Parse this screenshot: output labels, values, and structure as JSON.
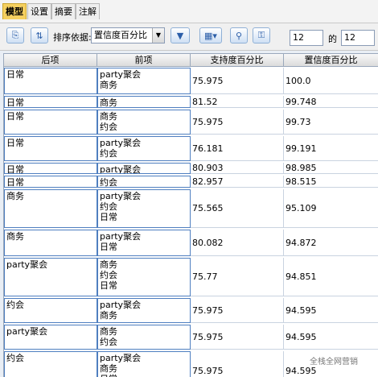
{
  "tabs": [
    "模型",
    "设置",
    "摘要",
    "注解"
  ],
  "toolbar": {
    "sort_label": "排序依据:",
    "sort_value": "置信度百分比",
    "page_current": "12",
    "of_label": "的",
    "page_total": "12"
  },
  "table": {
    "headers": [
      "后项",
      "前项",
      "支持度百分比",
      "置信度百分比"
    ],
    "rows": [
      {
        "consequent": "日常",
        "antecedents": [
          "party聚会",
          "商务"
        ],
        "support": "75.975",
        "confidence": "100.0"
      },
      {
        "consequent": "日常",
        "antecedents": [
          "商务"
        ],
        "support": "81.52",
        "confidence": "99.748"
      },
      {
        "consequent": "日常",
        "antecedents": [
          "商务",
          "约会"
        ],
        "support": "75.975",
        "confidence": "99.73"
      },
      {
        "consequent": "日常",
        "antecedents": [
          "party聚会",
          "约会"
        ],
        "support": "76.181",
        "confidence": "99.191"
      },
      {
        "consequent": "日常",
        "antecedents": [
          "party聚会"
        ],
        "support": "80.903",
        "confidence": "98.985"
      },
      {
        "consequent": "日常",
        "antecedents": [
          "约会"
        ],
        "support": "82.957",
        "confidence": "98.515"
      },
      {
        "consequent": "商务",
        "antecedents": [
          "party聚会",
          "约会",
          "日常"
        ],
        "support": "75.565",
        "confidence": "95.109"
      },
      {
        "consequent": "商务",
        "antecedents": [
          "party聚会",
          "日常"
        ],
        "support": "80.082",
        "confidence": "94.872"
      },
      {
        "consequent": "party聚会",
        "antecedents": [
          "商务",
          "约会",
          "日常"
        ],
        "support": "75.77",
        "confidence": "94.851"
      },
      {
        "consequent": "约会",
        "antecedents": [
          "party聚会",
          "商务"
        ],
        "support": "75.975",
        "confidence": "94.595"
      },
      {
        "consequent": "party聚会",
        "antecedents": [
          "商务",
          "约会"
        ],
        "support": "75.975",
        "confidence": "94.595"
      },
      {
        "consequent": "约会",
        "antecedents": [
          "party聚会",
          "商务",
          "日常"
        ],
        "support": "75.975",
        "confidence": "94.595"
      }
    ]
  },
  "watermark": "全栈全网营销"
}
